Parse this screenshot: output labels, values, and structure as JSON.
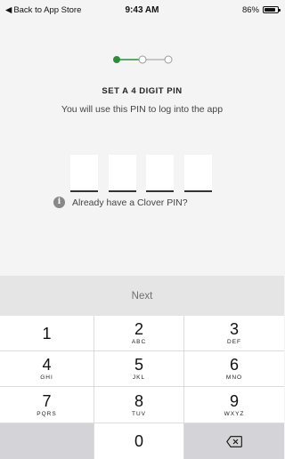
{
  "status_bar": {
    "back_label": "Back to App Store",
    "time": "9:43 AM",
    "battery": "86%",
    "battery_level": 0.86
  },
  "progress": {
    "steps": 3,
    "current_step": 1,
    "accent": "#2e8b3a"
  },
  "heading": {
    "title": "SET A 4 DIGIT PIN",
    "subtitle": "You will use this PIN to log into the app"
  },
  "pin": {
    "length": 4
  },
  "info": {
    "text": "Already have a Clover PIN?",
    "icon": "info-icon"
  },
  "next_button": {
    "label": "Next"
  },
  "keypad": {
    "keys": [
      {
        "num": "1",
        "letters": ""
      },
      {
        "num": "2",
        "letters": "ABC"
      },
      {
        "num": "3",
        "letters": "DEF"
      },
      {
        "num": "4",
        "letters": "GHI"
      },
      {
        "num": "5",
        "letters": "JKL"
      },
      {
        "num": "6",
        "letters": "MNO"
      },
      {
        "num": "7",
        "letters": "PQRS"
      },
      {
        "num": "8",
        "letters": "TUV"
      },
      {
        "num": "9",
        "letters": "WXYZ"
      },
      {
        "num": "0",
        "letters": ""
      }
    ],
    "delete_icon": "backspace-icon"
  }
}
